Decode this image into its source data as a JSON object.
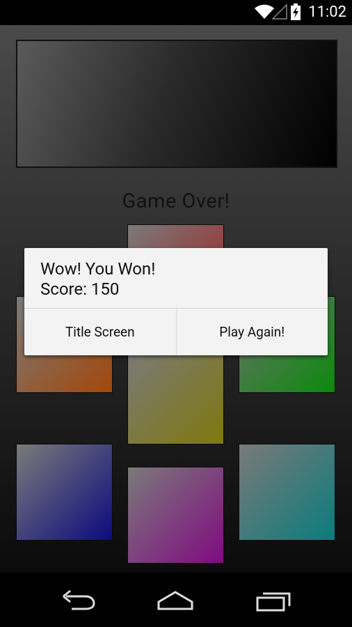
{
  "status_bar": {
    "time": "11:02"
  },
  "game": {
    "title": "Game Over!",
    "pads": [
      {
        "color_name": "red",
        "hex": "#a21d1d"
      },
      {
        "color_name": "orange",
        "hex": "#a3470a"
      },
      {
        "color_name": "green",
        "hex": "#0b8a0b"
      },
      {
        "color_name": "yellow",
        "hex": "#7f780c"
      },
      {
        "color_name": "blue",
        "hex": "#0b0b7f"
      },
      {
        "color_name": "purple",
        "hex": "#800a80"
      },
      {
        "color_name": "teal",
        "hex": "#0b7b7b"
      }
    ]
  },
  "dialog": {
    "message_line1": "Wow! You Won!",
    "message_line2": "Score: 150",
    "negative_button": "Title Screen",
    "positive_button": "Play Again!"
  },
  "nav_bar": {
    "icons": [
      "back-icon",
      "home-icon",
      "recents-icon"
    ]
  }
}
